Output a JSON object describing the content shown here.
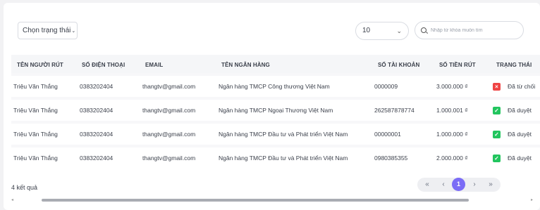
{
  "filters": {
    "status_select": "Chọn trạng thái",
    "page_size": "10",
    "search_placeholder": "Nhập từ khóa muốn tìm"
  },
  "table": {
    "headers": [
      "TÊN NGƯỜI RÚT",
      "SỐ ĐIỆN THOẠI",
      "EMAIL",
      "TÊN NGÂN HÀNG",
      "SỐ TÀI KHOẢN",
      "SỐ TIỀN RÚT",
      "TRẠNG THÁI"
    ],
    "rows": [
      {
        "name": "Triệu Văn Thắng",
        "phone": "0383202404",
        "email": "thangtv@gmail.com",
        "bank": "Ngân hàng TMCP Công thương Việt Nam",
        "account": "0000009",
        "amount": "3.000.000 ₫",
        "status": "Đã từ chối",
        "status_type": "rejected"
      },
      {
        "name": "Triệu Văn Thắng",
        "phone": "0383202404",
        "email": "thangtv@gmail.com",
        "bank": "Ngân hàng TMCP Ngoại Thương Việt Nam",
        "account": "262587878774",
        "amount": "1.000.001 ₫",
        "status": "Đã duyệt",
        "status_type": "approved"
      },
      {
        "name": "Triệu Văn Thắng",
        "phone": "0383202404",
        "email": "thangtv@gmail.com",
        "bank": "Ngân hàng TMCP Đầu tư và Phát triển Việt Nam",
        "account": "00000001",
        "amount": "1.000.000 ₫",
        "status": "Đã duyệt",
        "status_type": "approved"
      },
      {
        "name": "Triệu Văn Thắng",
        "phone": "0383202404",
        "email": "thangtv@gmail.com",
        "bank": "Ngân hàng TMCP Đầu tư và Phát triển Việt Nam",
        "account": "0980385355",
        "amount": "2.000.000 ₫",
        "status": "Đã duyệt",
        "status_type": "approved"
      }
    ]
  },
  "footer": {
    "result_count": "4 kết quả",
    "pager": {
      "first": "«",
      "prev": "‹",
      "current": "1",
      "next": "›",
      "last": "»"
    }
  },
  "colors": {
    "accent": "#7b6cf6",
    "approved": "#22c55e",
    "rejected": "#ef4444"
  }
}
